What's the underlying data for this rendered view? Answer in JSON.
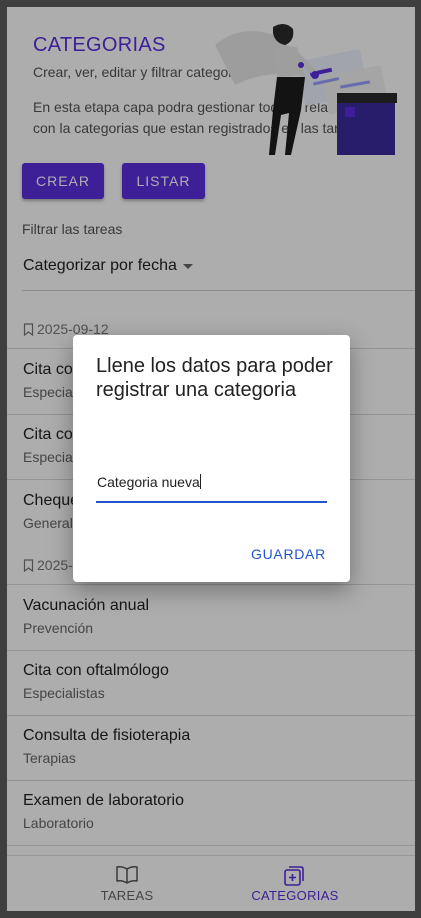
{
  "header": {
    "title": "CATEGORIAS",
    "subtitle": "Crear, ver, editar y filtrar categorias",
    "description": "En esta etapa capa podra gestionar todo lo relacionado con la categorias que estan registrados en las tareas"
  },
  "actions": {
    "create_label": "CREAR",
    "list_label": "LISTAR"
  },
  "filter": {
    "label": "Filtrar las tareas",
    "selected": "Categorizar por fecha"
  },
  "groups": [
    {
      "date": "2025-09-12",
      "items": [
        {
          "title": "Cita co",
          "subtitle": "Especia"
        },
        {
          "title": "Cita co",
          "subtitle": "Especia"
        },
        {
          "title": "Cheque",
          "subtitle": "General"
        }
      ]
    },
    {
      "date": "2025-",
      "items": [
        {
          "title": "Vacunación anual",
          "subtitle": "Prevención"
        },
        {
          "title": "Cita con oftalmólogo",
          "subtitle": "Especialistas"
        },
        {
          "title": "Consulta de fisioterapia",
          "subtitle": "Terapias"
        },
        {
          "title": "Examen de laboratorio",
          "subtitle": "Laboratorio"
        }
      ]
    }
  ],
  "dialog": {
    "title": "Llene los datos para poder registrar una categoria",
    "input_value": "Categoria nueva",
    "save_label": "GUARDAR"
  },
  "bottom_nav": {
    "tareas_label": "TAREAS",
    "categorias_label": "CATEGORIAS",
    "tareas_icon": "book-open-icon",
    "categorias_icon": "add-box-icon",
    "active": "categorias"
  },
  "colors": {
    "primary": "#5b2fe0",
    "accent_blue": "#2255cc",
    "scrim": "rgba(0,0,0,0.32)"
  }
}
